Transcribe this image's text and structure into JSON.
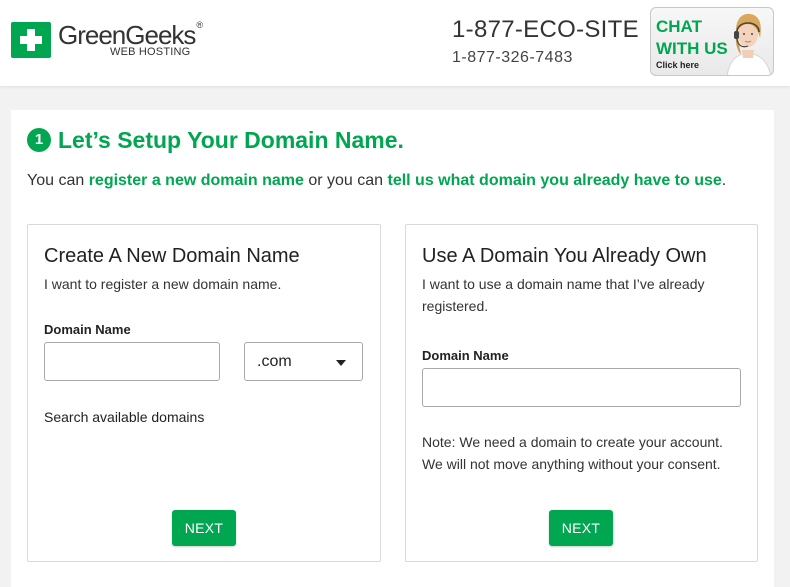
{
  "header": {
    "logo_name": "GreenGeeks",
    "logo_reg": "®",
    "logo_sub": "WEB HOSTING",
    "phone_vanity": "1-877-ECO-SITE",
    "phone_number": "1-877-326-7483",
    "chat": {
      "line1": "CHAT",
      "line2": "WITH US",
      "click": "Click here"
    }
  },
  "step": {
    "number": "1",
    "title": "Let’s Setup Your Domain Name.",
    "intro_prefix": "You can ",
    "intro_link1": "register a new domain name",
    "intro_middle": " or you can ",
    "intro_link2": "tell us what domain you already have to use",
    "intro_suffix": "."
  },
  "new_domain": {
    "title": "Create A New Domain Name",
    "description": "I want to register a new domain name.",
    "field_label": "Domain Name",
    "input_value": "",
    "tld_selected": ".com",
    "search_text": "Search available domains",
    "next_label": "NEXT"
  },
  "own_domain": {
    "title": "Use A Domain You Already Own",
    "description": "I want to use a domain name that I’ve already registered.",
    "field_label": "Domain Name",
    "input_value": "",
    "note_line1": "Note: We need a domain to create your account.",
    "note_line2": "We will not move anything without your consent.",
    "next_label": "NEXT"
  },
  "colors": {
    "brand_green": "#00a650",
    "page_bg": "#f2f2f2"
  },
  "icons": {
    "logo": "greengeeks-plus-icon",
    "chat_agent": "support-agent-icon",
    "dropdown": "caret-down-icon"
  }
}
